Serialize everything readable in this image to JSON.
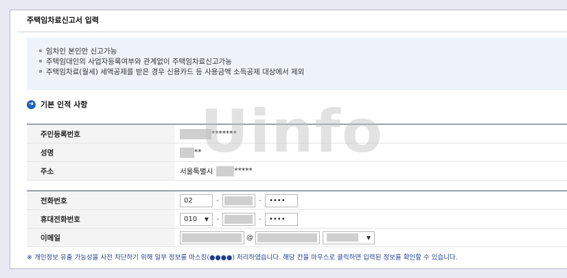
{
  "title": "주택임차료신고서 입력",
  "notice": {
    "lines": [
      "임차인 본인만 신고가능",
      "주택임대인의 사업자등록여부와 관계없이 주택임차료신고가능",
      "주택임차료(월세) 세액공제를 받은 경우 신용카드 등 사용금액 소득공제 대상에서 제외"
    ]
  },
  "section": {
    "title": "기본 인적 사항",
    "icon": "arrow-right-circle-icon"
  },
  "basic": {
    "rrn_label": "주민등록번호",
    "rrn_masked": "*******",
    "name_label": "성명",
    "name_masked": "**",
    "address_label": "주소",
    "address_prefix": "서울특별시",
    "address_masked": "*****"
  },
  "contact": {
    "phone_label": "전화번호",
    "phone_area": "02",
    "phone_last": "••••",
    "mobile_label": "휴대전화번호",
    "mobile_prefix": "010",
    "mobile_last": "••••",
    "email_label": "이메일",
    "email_at": "@"
  },
  "footnote": "※ 개인정보 유출 가능성을 사전 차단하기 위해 일부 정보를 마스킹(●●●●) 처리하였습니다. 해당 칸을 마우스로 클릭하면 입력된 정보를 확인할 수 있습니다.",
  "watermark": "Uinfo"
}
